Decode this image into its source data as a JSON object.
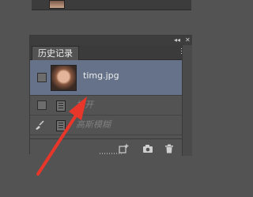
{
  "panel": {
    "title": "历史记录",
    "state_name": "timg.jpg",
    "history_items": [
      "打开",
      "高斯模糊"
    ]
  },
  "icons": {
    "dock_collapse": "◂◂",
    "dock_close": "✕",
    "panel_menu": "panel-menu-icon",
    "new_document": "new-document-from-state-icon",
    "snapshot": "create-snapshot-icon",
    "delete": "trash-icon",
    "history_brush": "history-brush-icon"
  },
  "colors": {
    "selected_row": "#66728a",
    "annotation_arrow": "#e8362a"
  }
}
